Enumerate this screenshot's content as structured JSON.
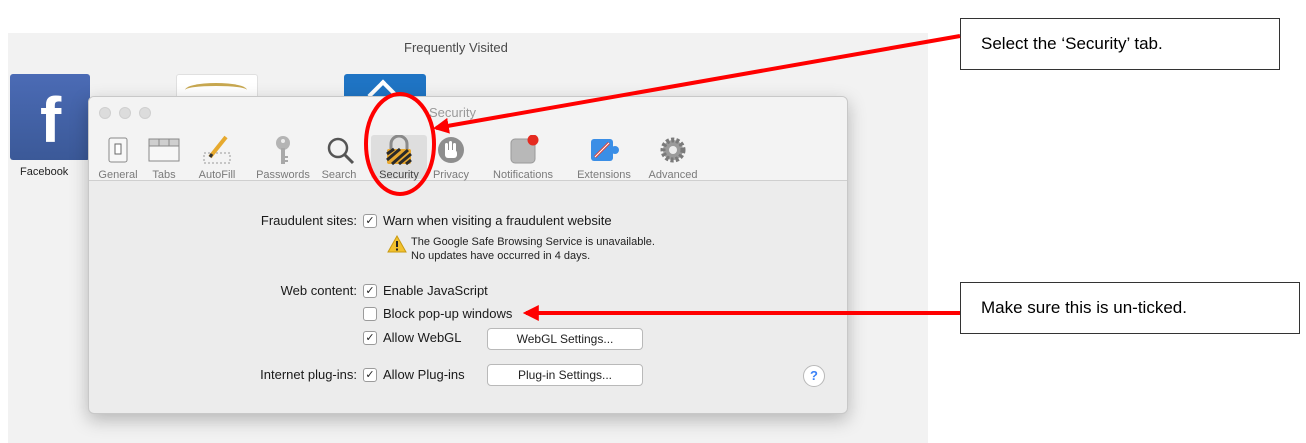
{
  "background": {
    "section_title": "Frequently Visited",
    "tiles": [
      {
        "label": "Facebook"
      }
    ]
  },
  "dialog": {
    "title": "Security",
    "toolbar": [
      {
        "label": "General",
        "icon": "general-switch-icon"
      },
      {
        "label": "Tabs",
        "icon": "tabs-icon"
      },
      {
        "label": "AutoFill",
        "icon": "pencil-icon"
      },
      {
        "label": "Passwords",
        "icon": "key-icon"
      },
      {
        "label": "Search",
        "icon": "magnifier-icon"
      },
      {
        "label": "Security",
        "icon": "padlock-icon",
        "selected": true
      },
      {
        "label": "Privacy",
        "icon": "hand-icon"
      },
      {
        "label": "Notifications",
        "icon": "notification-icon"
      },
      {
        "label": "Extensions",
        "icon": "puzzle-icon"
      },
      {
        "label": "Advanced",
        "icon": "gear-icon"
      }
    ],
    "fraudulent": {
      "label": "Fraudulent sites:",
      "checkbox_label": "Warn when visiting a fraudulent website",
      "checked": true,
      "warning_line1": "The Google Safe Browsing Service is unavailable.",
      "warning_line2": "No updates have occurred in 4 days."
    },
    "web_content": {
      "label": "Web content:",
      "options": [
        {
          "label": "Enable JavaScript",
          "checked": true
        },
        {
          "label": "Block pop-up windows",
          "checked": false
        },
        {
          "label": "Allow WebGL",
          "checked": true
        }
      ],
      "webgl_button": "WebGL Settings..."
    },
    "plugins": {
      "label": "Internet plug-ins:",
      "checkbox_label": "Allow Plug-ins",
      "checked": true,
      "button": "Plug-in Settings..."
    },
    "help": "?"
  },
  "annotations": {
    "callout_security": "Select the ‘Security’ tab.",
    "callout_popup": "Make sure this is un-ticked.",
    "accent_color": "#ff0000"
  },
  "colors": {
    "facebook_blue": "#3b5998",
    "dialog_bg": "#ececec",
    "help_blue": "#3a82f7"
  }
}
